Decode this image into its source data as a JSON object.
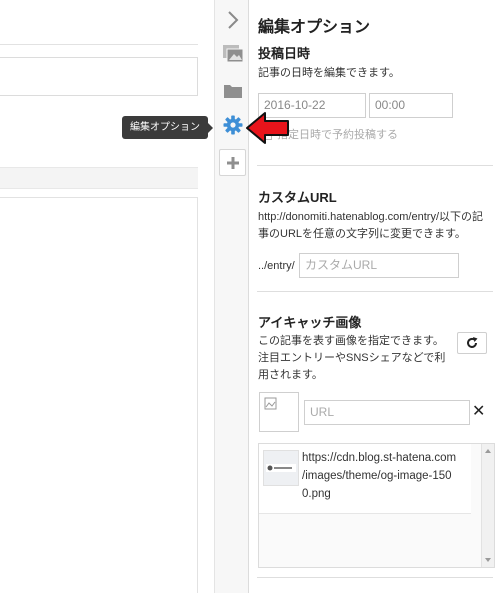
{
  "tooltip": {
    "text": "編集オプション"
  },
  "rail": {
    "icons": [
      "collapse-chevron-icon",
      "image-icon",
      "folder-icon",
      "gear-icon",
      "plus-icon"
    ],
    "accent": "#3e8fd6"
  },
  "panel": {
    "title": "編集オプション",
    "post_date": {
      "heading": "投稿日時",
      "desc": "記事の日時を編集できます。",
      "date_value": "2016-10-22",
      "time_value": "00:00",
      "reserve_label": "指定日時で予約投稿する"
    },
    "custom_url": {
      "heading": "カスタムURL",
      "desc_line1": "http://donomiti.hatenablog.com/entry/以下の記",
      "desc_line2": "事のURLを任意の文字列に変更できます。",
      "prefix": "../entry/",
      "placeholder": "カスタムURL"
    },
    "eyecatch": {
      "heading": "アイキャッチ画像",
      "desc_line1": "この記事を表す画像を指定できます。",
      "desc_line2": "注目エントリーやSNSシェアなどで利",
      "desc_line3": "用されます。",
      "url_placeholder": "URL",
      "close_glyph": "✕",
      "images": [
        {
          "url_line1": "https://cdn.blog.st-hatena.com",
          "url_line2": "/images/theme/og-image-150",
          "url_line3": "0.png"
        }
      ]
    }
  },
  "annotation_color": "#e8141b"
}
